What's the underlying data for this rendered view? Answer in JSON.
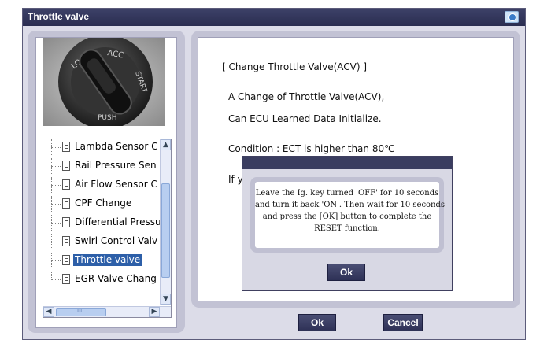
{
  "window": {
    "title": "Throttle valve"
  },
  "tree": {
    "items": [
      {
        "label": "Lambda Sensor C",
        "selected": false
      },
      {
        "label": "Rail Pressure Sen",
        "selected": false
      },
      {
        "label": "Air Flow Sensor C",
        "selected": false
      },
      {
        "label": "CPF Change",
        "selected": false
      },
      {
        "label": "Differential Pressu",
        "selected": false
      },
      {
        "label": "Swirl Control Valv",
        "selected": false
      },
      {
        "label": "Throttle valve",
        "selected": true
      },
      {
        "label": "EGR Valve Chang",
        "selected": false
      }
    ],
    "hscroll_thumb": "III"
  },
  "key_image": {
    "labels": [
      "LOCK",
      "ACC",
      "START",
      "PUSH"
    ]
  },
  "content": {
    "heading": "[ Change Throttle Valve(ACV) ]",
    "line1": "A Change of Throttle Valve(ACV),",
    "line2": "Can ECU Learned Data Initialize.",
    "condition": "Condition :  ECT is higher than 80℃",
    "partial": "If y"
  },
  "dialog": {
    "message_lines": [
      "Leave the Ig. key turned 'OFF' for 10 seconds",
      "and turn it back 'ON'. Then wait for 10 seconds",
      "and press the [OK] button to complete the",
      "RESET function."
    ],
    "ok_label": "Ok"
  },
  "buttons": {
    "ok": "Ok",
    "cancel": "Cancel"
  }
}
